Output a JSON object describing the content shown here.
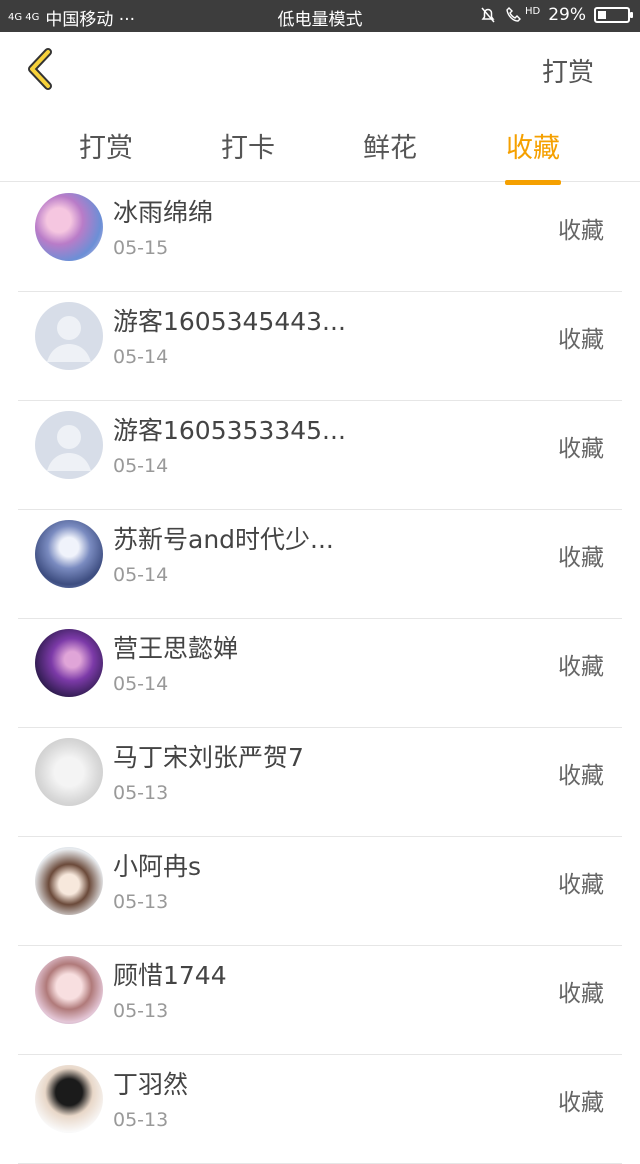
{
  "status_bar": {
    "network": "4G 4G",
    "carrier": "中国移动 ···",
    "mode": "低电量模式",
    "hd": "HD",
    "battery": "29%",
    "battery_level": 0.29
  },
  "header": {
    "action_label": "打赏"
  },
  "tabs": [
    {
      "label": "打赏"
    },
    {
      "label": "打卡"
    },
    {
      "label": "鲜花"
    },
    {
      "label": "收藏"
    }
  ],
  "active_tab": "收藏",
  "list": [
    {
      "name": "冰雨绵绵",
      "date": "05-15",
      "action": "收藏",
      "avatar": "anime"
    },
    {
      "name": "游客1605345443...",
      "date": "05-14",
      "action": "收藏",
      "avatar": "default"
    },
    {
      "name": "游客1605353345...",
      "date": "05-14",
      "action": "收藏",
      "avatar": "default"
    },
    {
      "name": "苏新号and时代少...",
      "date": "05-14",
      "action": "收藏",
      "avatar": "group"
    },
    {
      "name": "营王思懿婵",
      "date": "05-14",
      "action": "收藏",
      "avatar": "game"
    },
    {
      "name": "马丁宋刘张严贺7",
      "date": "05-13",
      "action": "收藏",
      "avatar": "sketch"
    },
    {
      "name": "小阿冉s",
      "date": "05-13",
      "action": "收藏",
      "avatar": "photo"
    },
    {
      "name": "顾惜1744",
      "date": "05-13",
      "action": "收藏",
      "avatar": "photo2"
    },
    {
      "name": "丁羽然",
      "date": "05-13",
      "action": "收藏",
      "avatar": "photo3"
    }
  ],
  "colors": {
    "accent": "#f5a000",
    "statusbar": "#3d3d3d"
  }
}
